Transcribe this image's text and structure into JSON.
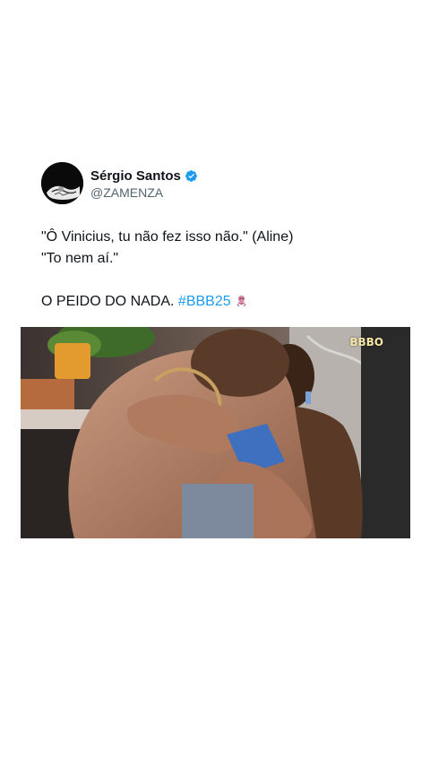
{
  "tweet": {
    "author": {
      "display_name": "Sérgio Santos",
      "handle": "@ZAMENZA",
      "verified": true,
      "verified_color": "#1d9bf0"
    },
    "lines": [
      "\"Ô Vinicius, tu não fez isso não.\" (Aline)",
      "\"To nem aí.\""
    ],
    "last_line_text": "O PEIDO DO NADA. ",
    "hashtag": "#BBB25",
    "emoji_icon": "gorilla-icon",
    "hashtag_color": "#1d9bf0"
  },
  "media": {
    "type": "video-frame",
    "watermark": "BBBO"
  }
}
